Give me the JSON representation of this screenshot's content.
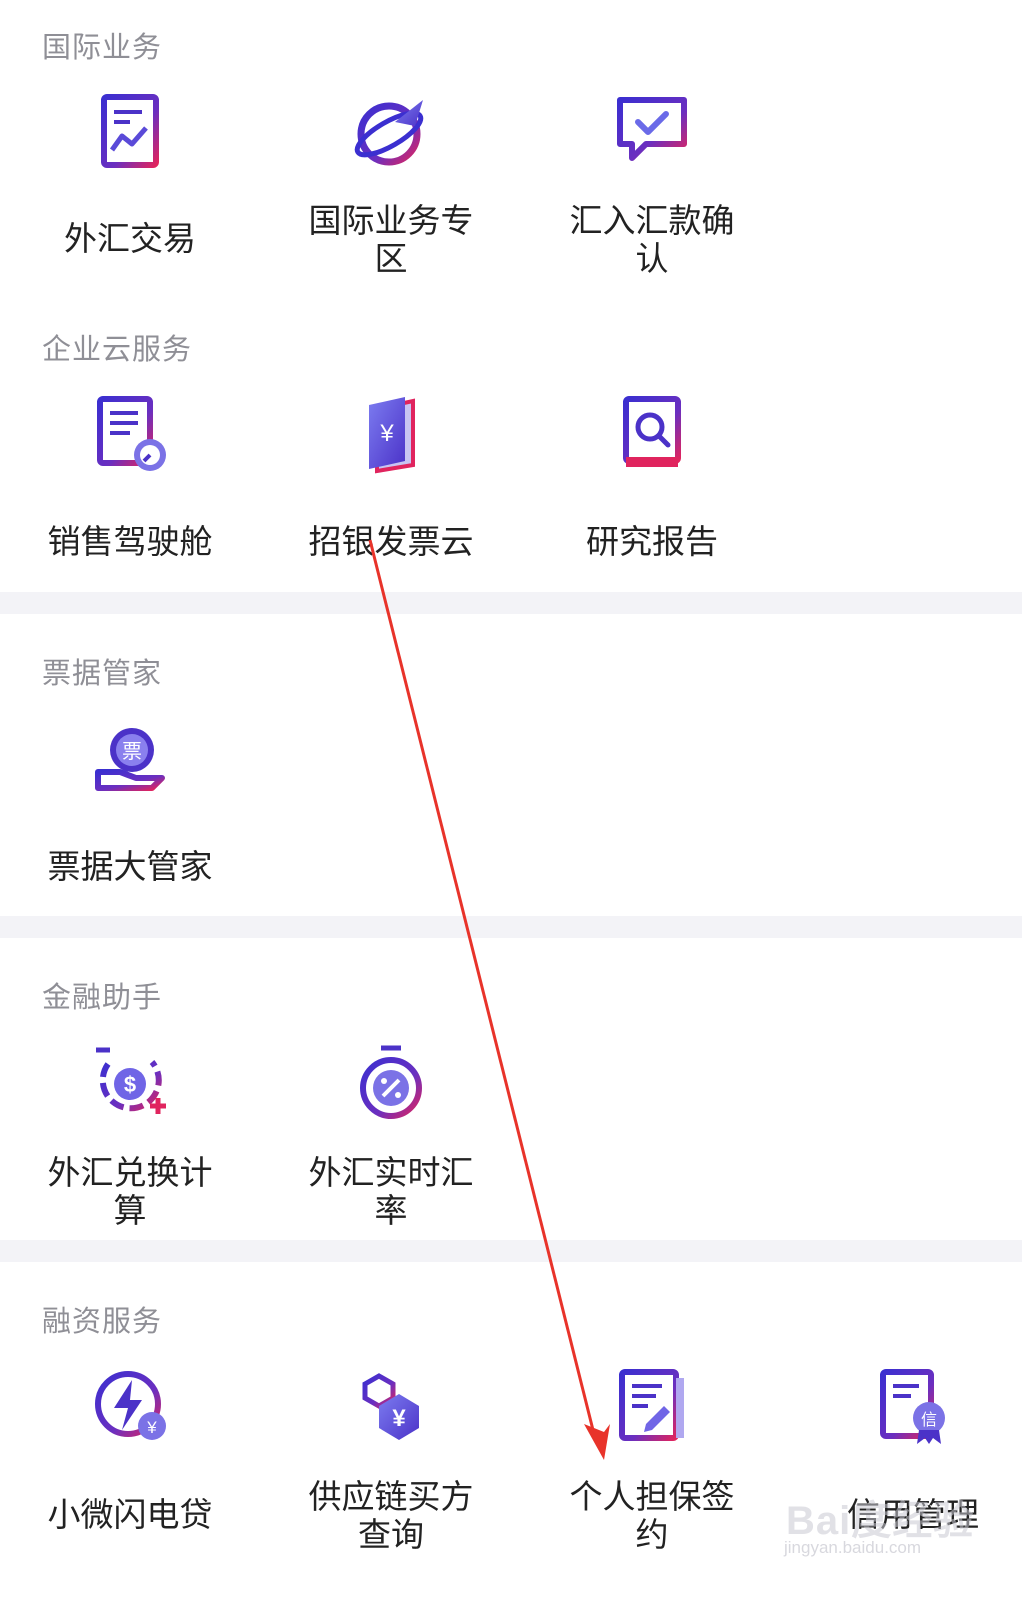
{
  "sections": [
    {
      "title": "国际业务",
      "items": [
        {
          "label": "外汇交易",
          "icon": "forex-chart-document-icon"
        },
        {
          "label": "国际业务专区",
          "icon": "globe-plane-icon"
        },
        {
          "label": "汇入汇款确认",
          "icon": "chat-check-icon"
        }
      ]
    },
    {
      "title": "企业云服务",
      "items": [
        {
          "label": "销售驾驶舱",
          "icon": "report-gauge-icon"
        },
        {
          "label": "招银发票云",
          "icon": "invoice-yuan-book-icon"
        },
        {
          "label": "研究报告",
          "icon": "research-book-search-icon"
        }
      ]
    },
    {
      "title": "票据管家",
      "items": [
        {
          "label": "票据大管家",
          "icon": "bill-hand-icon"
        }
      ]
    },
    {
      "title": "金融助手",
      "items": [
        {
          "label": "外汇兑换计算",
          "icon": "dollar-exchange-icon"
        },
        {
          "label": "外汇实时汇率",
          "icon": "percent-stopwatch-icon"
        }
      ]
    },
    {
      "title": "融资服务",
      "items": [
        {
          "label": "小微闪电贷",
          "icon": "lightning-loan-icon"
        },
        {
          "label": "供应链买方查询",
          "icon": "supply-chain-yuan-icon"
        },
        {
          "label": "个人担保签约",
          "icon": "sign-document-pen-icon"
        },
        {
          "label": "信用管理",
          "icon": "credit-certificate-icon"
        }
      ]
    }
  ],
  "watermark": {
    "brand": "Bai度经验",
    "url": "jingyan.baidu.com"
  },
  "colors": {
    "accent_purple": "#4b32c8",
    "accent_red": "#e0245e",
    "annotation_arrow": "#e8332a",
    "section_gap": "#f3f3f7"
  }
}
